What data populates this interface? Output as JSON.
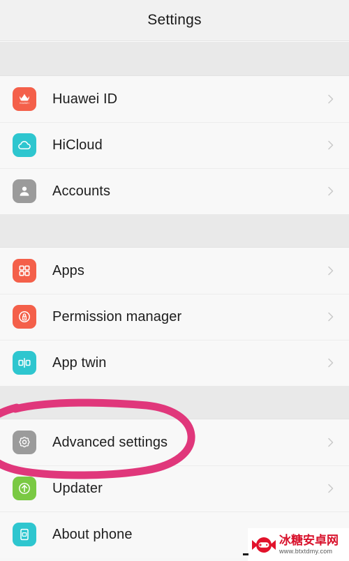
{
  "header": {
    "title": "Settings"
  },
  "colors": {
    "huawei_red": "#f4604a",
    "hicloud_teal": "#2ec6cf",
    "accounts_gray": "#9b9b9b",
    "apps_orange": "#f4604a",
    "permission_orange": "#f4604a",
    "apptwin_teal": "#2ec6cf",
    "advanced_gray": "#9b9b9b",
    "updater_green": "#7ac943",
    "about_teal": "#2ec6cf",
    "annotation_pink": "#e0377b",
    "row_background": "#f8f8f8",
    "gap_background": "#e9e9e9",
    "chevron_gray": "#c9c9c9",
    "label_text": "#1d1d1d"
  },
  "groups": [
    {
      "name": "account-group",
      "items": [
        {
          "label": "Huawei ID",
          "icon": "huawei-logo-icon",
          "chevron": "chevron-right-icon"
        },
        {
          "label": "HiCloud",
          "icon": "cloud-icon",
          "chevron": "chevron-right-icon"
        },
        {
          "label": "Accounts",
          "icon": "person-icon",
          "chevron": "chevron-right-icon"
        }
      ]
    },
    {
      "name": "apps-group",
      "items": [
        {
          "label": "Apps",
          "icon": "grid-squares-icon",
          "chevron": "chevron-right-icon"
        },
        {
          "label": "Permission manager",
          "icon": "lock-shield-icon",
          "chevron": "chevron-right-icon"
        },
        {
          "label": "App twin",
          "icon": "app-twin-icon",
          "chevron": "chevron-right-icon"
        }
      ]
    },
    {
      "name": "system-group",
      "items": [
        {
          "label": "Advanced settings",
          "icon": "gear-icon",
          "chevron": "chevron-right-icon"
        },
        {
          "label": "Updater",
          "icon": "up-arrow-circle-icon",
          "chevron": "chevron-right-icon"
        },
        {
          "label": "About phone",
          "icon": "phone-info-icon",
          "chevron": "chevron-right-icon"
        }
      ]
    }
  ],
  "annotation": {
    "name": "pink-ellipse-highlight",
    "target": "Advanced settings",
    "color": "#e0377b"
  },
  "watermark": {
    "site_name": "冰糖安卓网",
    "url": "www.btxtdmy.com",
    "logo": "candy-gamepad-icon"
  }
}
